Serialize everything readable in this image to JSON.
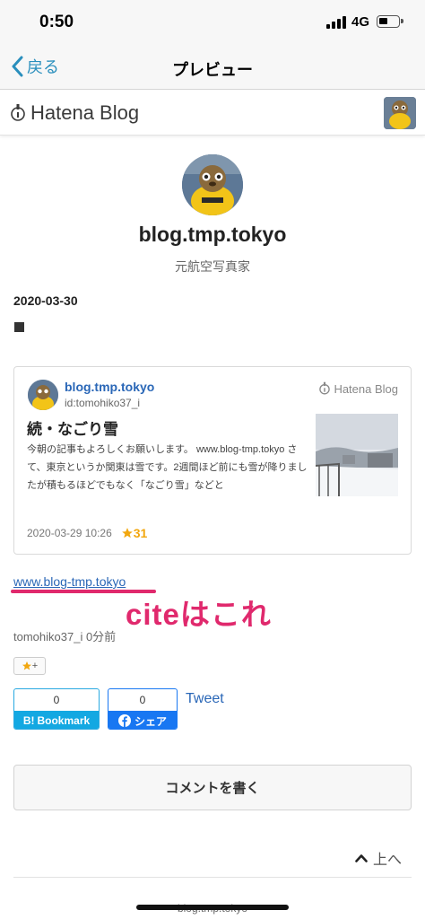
{
  "status_bar": {
    "time": "0:50",
    "network": "4G"
  },
  "nav": {
    "back_label": "戻る",
    "title": "プレビュー"
  },
  "header": {
    "logo_text": "Hatena Blog",
    "logo_icon": "hatena-bottle-icon"
  },
  "profile": {
    "blog_title": "blog.tmp.tokyo",
    "description": "元航空写真家"
  },
  "post": {
    "date": "2020-03-30"
  },
  "embed_card": {
    "blog_name": "blog.tmp.tokyo",
    "user_id": "id:tomohiko37_i",
    "logo_text": "Hatena Blog",
    "title": "続・なごり雪",
    "excerpt": "今朝の記事もよろしくお願いします。 www.blog-tmp.tokyo さて、東京というか関東は雪です。2週間ほど前にも雪が降りましたが積もるほどでもなく「なごり雪」などと",
    "datetime": "2020-03-29 10:26",
    "star_count": "31"
  },
  "cite": {
    "url": "www.blog-tmp.tokyo",
    "annotation": "citeはこれ",
    "annotation_color": "#e0296d"
  },
  "author_line": "tomohiko37_i 0分前",
  "star_add_label": "+",
  "share": {
    "bookmark_count": "0",
    "bookmark_label": "Bookmark",
    "facebook_count": "0",
    "facebook_label": "シェア",
    "tweet_label": "Tweet"
  },
  "comment_button_label": "コメントを書く",
  "to_top_label": "上へ",
  "footer_blog_name": "blog.tmp.tokyo",
  "colors": {
    "accent_link": "#2a67b7",
    "nav_back": "#2a8fbd",
    "hatebu_blue": "#13a8e2",
    "facebook_blue": "#1877f2",
    "star_gold": "#f2a70e"
  }
}
